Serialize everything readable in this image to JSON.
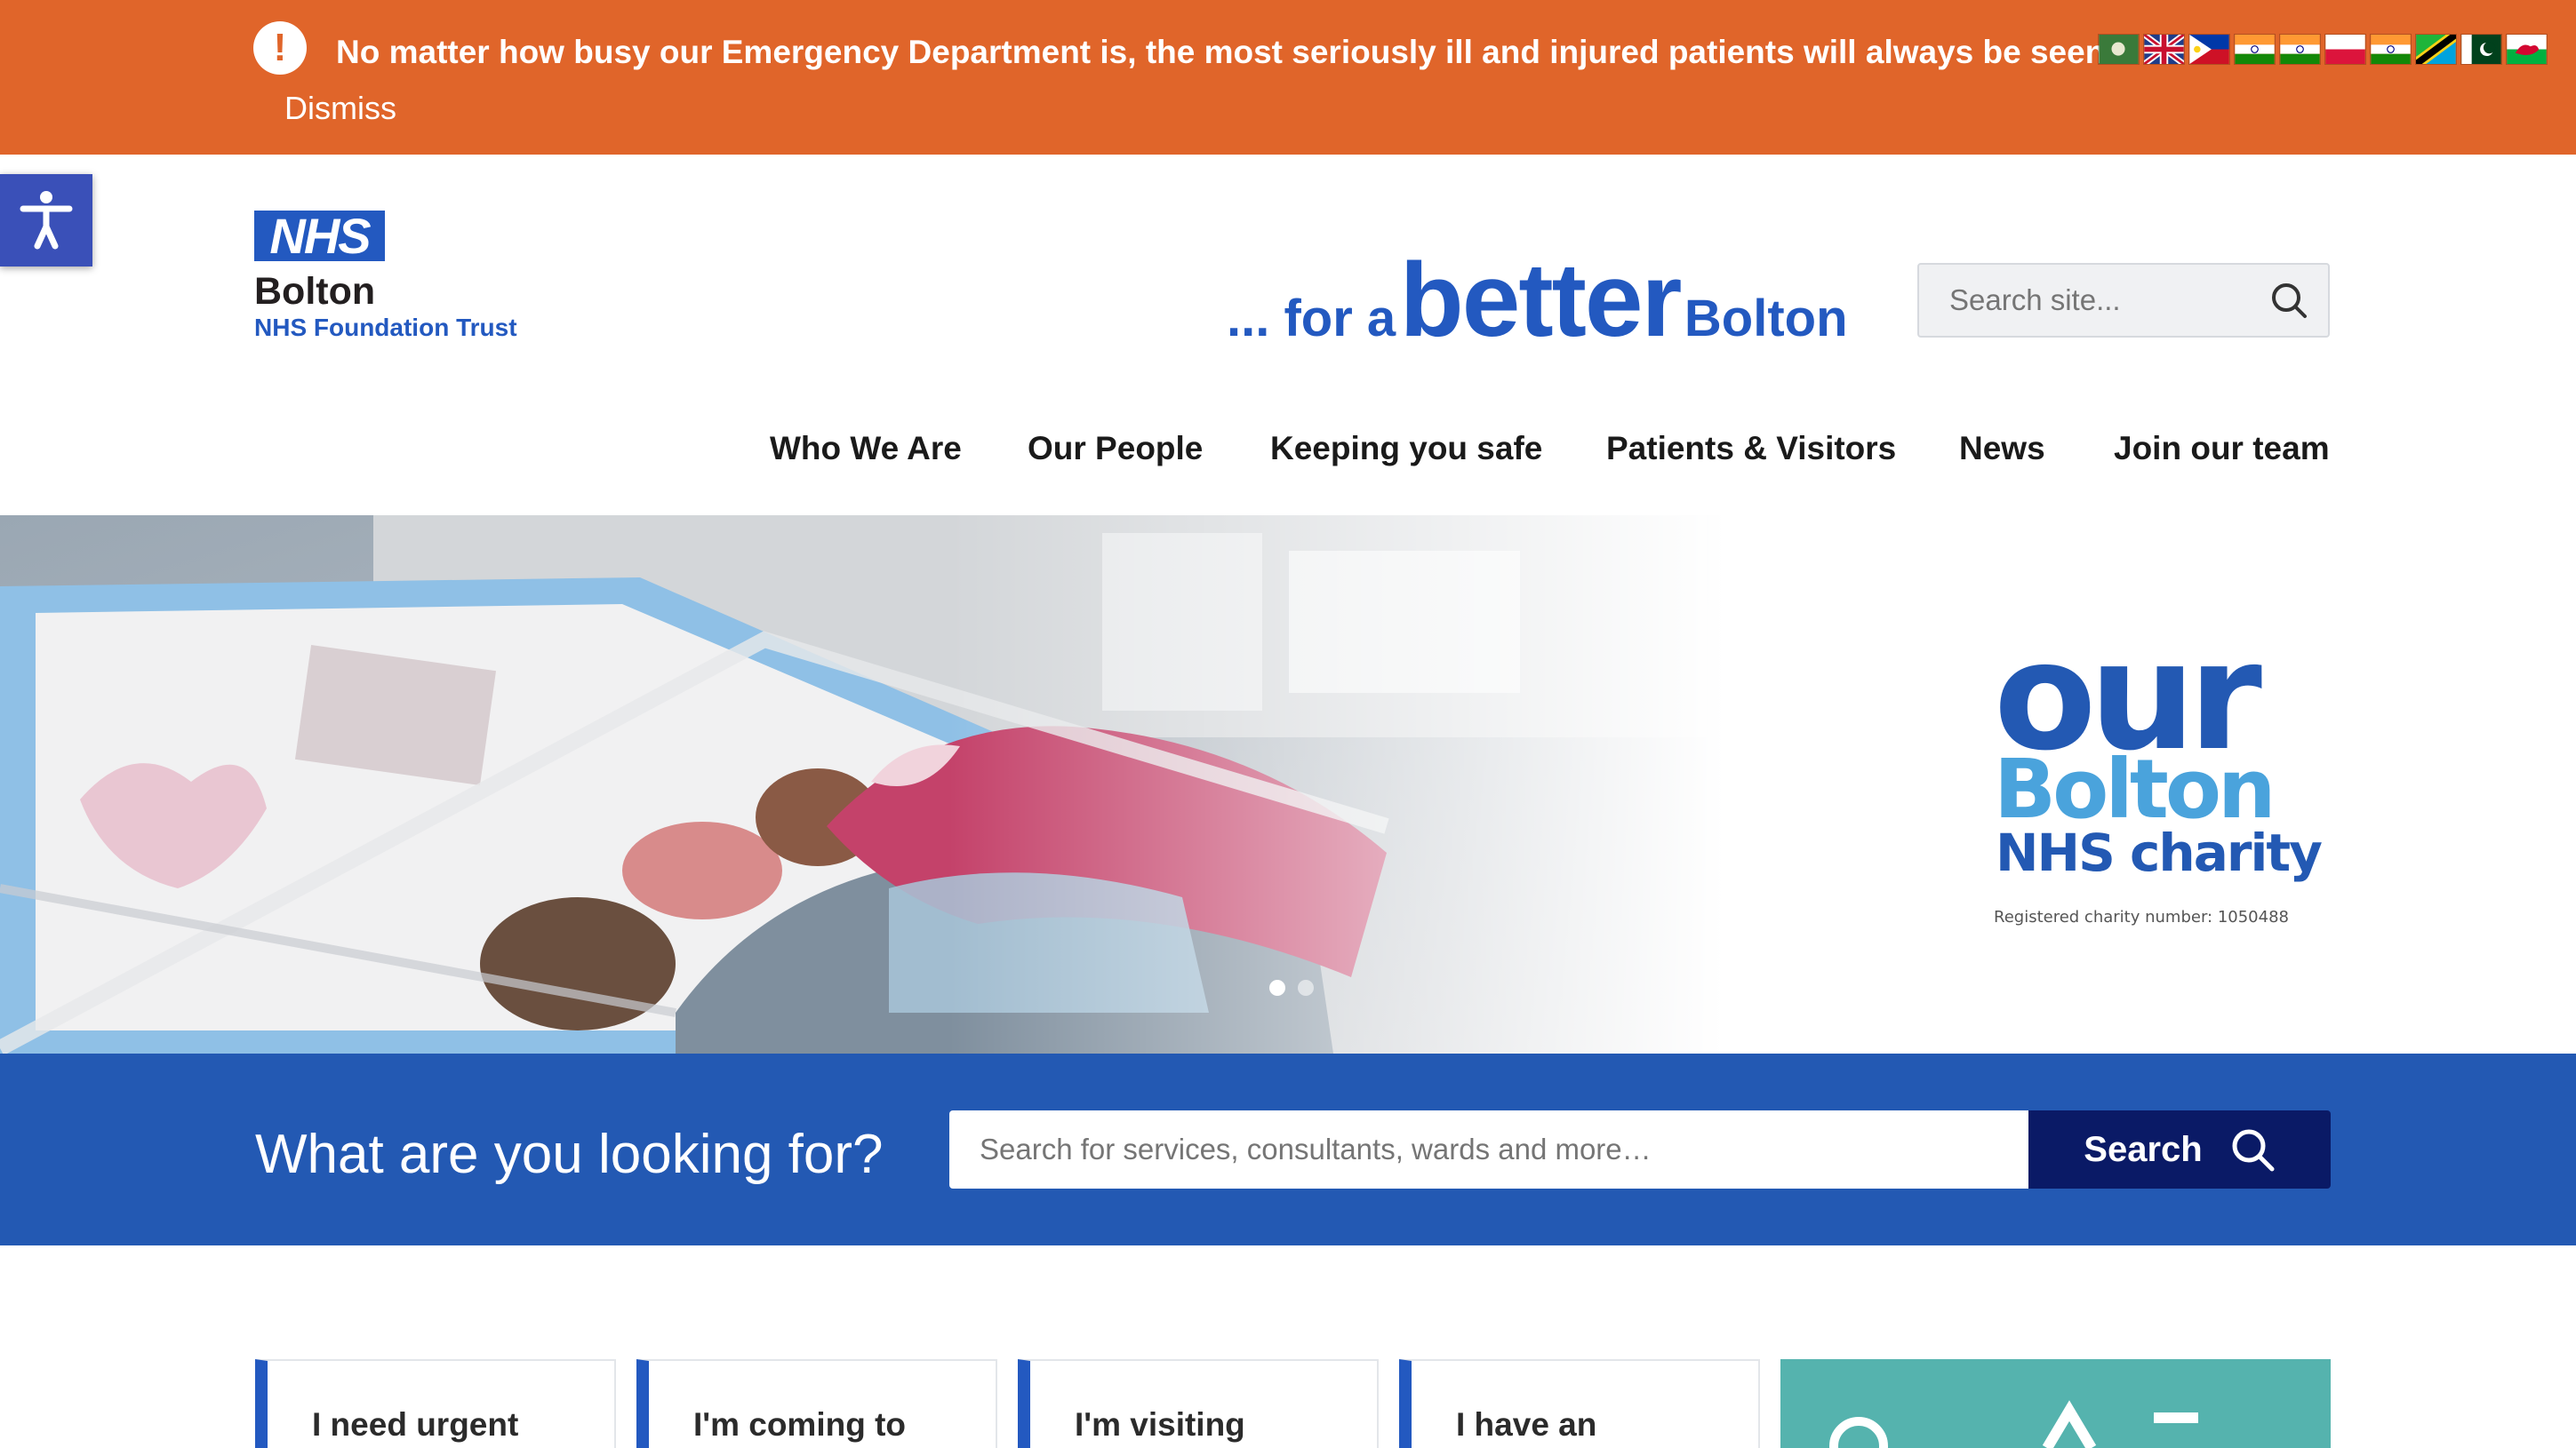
{
  "alert": {
    "message": "No matter how busy our Emergency Department is, the most seriously ill and injured patients will always be seen im",
    "icon": "exclamation-icon",
    "dismiss_label": "Dismiss",
    "background": "#e0652a"
  },
  "accessibility": {
    "icon": "accessibility-person-icon"
  },
  "logo": {
    "badge": "NHS",
    "name": "Bolton",
    "subtitle": "NHS Foundation Trust"
  },
  "tagline": {
    "prefix": "... for a",
    "emphasis": "better",
    "suffix": "Bolton"
  },
  "site_search": {
    "placeholder": "Search site..."
  },
  "nav": {
    "items": [
      {
        "label": "Who We Are"
      },
      {
        "label": "Our People"
      },
      {
        "label": "Keeping you safe"
      },
      {
        "label": "Patients & Visitors"
      },
      {
        "label": "News"
      },
      {
        "label": "Join our team"
      }
    ]
  },
  "hero": {
    "charity_line1": "our",
    "charity_line2": "Bolton",
    "charity_line3": "NHS charity",
    "charity_reg": "Registered charity number: 1050488",
    "slides": 2,
    "active_slide": 1
  },
  "search_band": {
    "title": "What are you looking for?",
    "placeholder": "Search for services, consultants, wards and more…",
    "button_label": "Search",
    "background": "#2359b3"
  },
  "quick_links": [
    {
      "label": "I need urgent"
    },
    {
      "label": "I'm coming to"
    },
    {
      "label": "I'm visiting"
    },
    {
      "label": "I have an"
    }
  ],
  "colors": {
    "nhs_blue": "#2359c0",
    "dark_navy": "#0a1a66",
    "teal": "#55b3ae"
  }
}
